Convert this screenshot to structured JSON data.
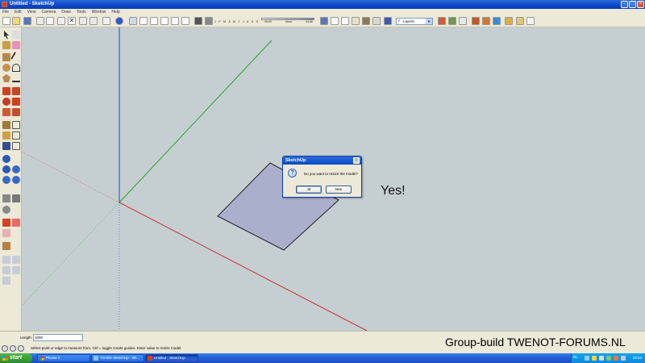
{
  "window": {
    "title": "Untitled - SketchUp"
  },
  "menu": [
    "File",
    "Edit",
    "View",
    "Camera",
    "Draw",
    "Tools",
    "Window",
    "Help"
  ],
  "shadow": {
    "months": "J F M A M J J A S O N D",
    "time_start": "06:43",
    "noon": "Noon",
    "time_end": "04:46"
  },
  "layer": {
    "selected": "Layer0"
  },
  "dialog": {
    "title": "SketchUp",
    "message": "Do you want to resize the model?",
    "yes_label": "Ja",
    "no_label": "Nee",
    "close": "X",
    "question_mark": "?"
  },
  "annotation": {
    "text": "Yes!"
  },
  "measurements": {
    "label": "Length",
    "value": "1000"
  },
  "status": {
    "text": "Select point or edge to measure from.  Ctrl = toggle create guides.  Enter value to resize model."
  },
  "watermark": {
    "text": "Group-build TWENOT-FORUMS.NL"
  },
  "taskbar": {
    "start_label": "start",
    "tasks": [
      "Picasa 3",
      "Trimble SketchUp - Wi...",
      "Untitled - SketchUp"
    ],
    "tray_lang": "NL",
    "clock": "10:24"
  },
  "colors": {
    "accent": "#0a46c8",
    "face": "#aab0cc",
    "face_edge": "#222222",
    "axis_red": "#c83030",
    "axis_green": "#2ea02e",
    "axis_blue": "#3040c8"
  }
}
